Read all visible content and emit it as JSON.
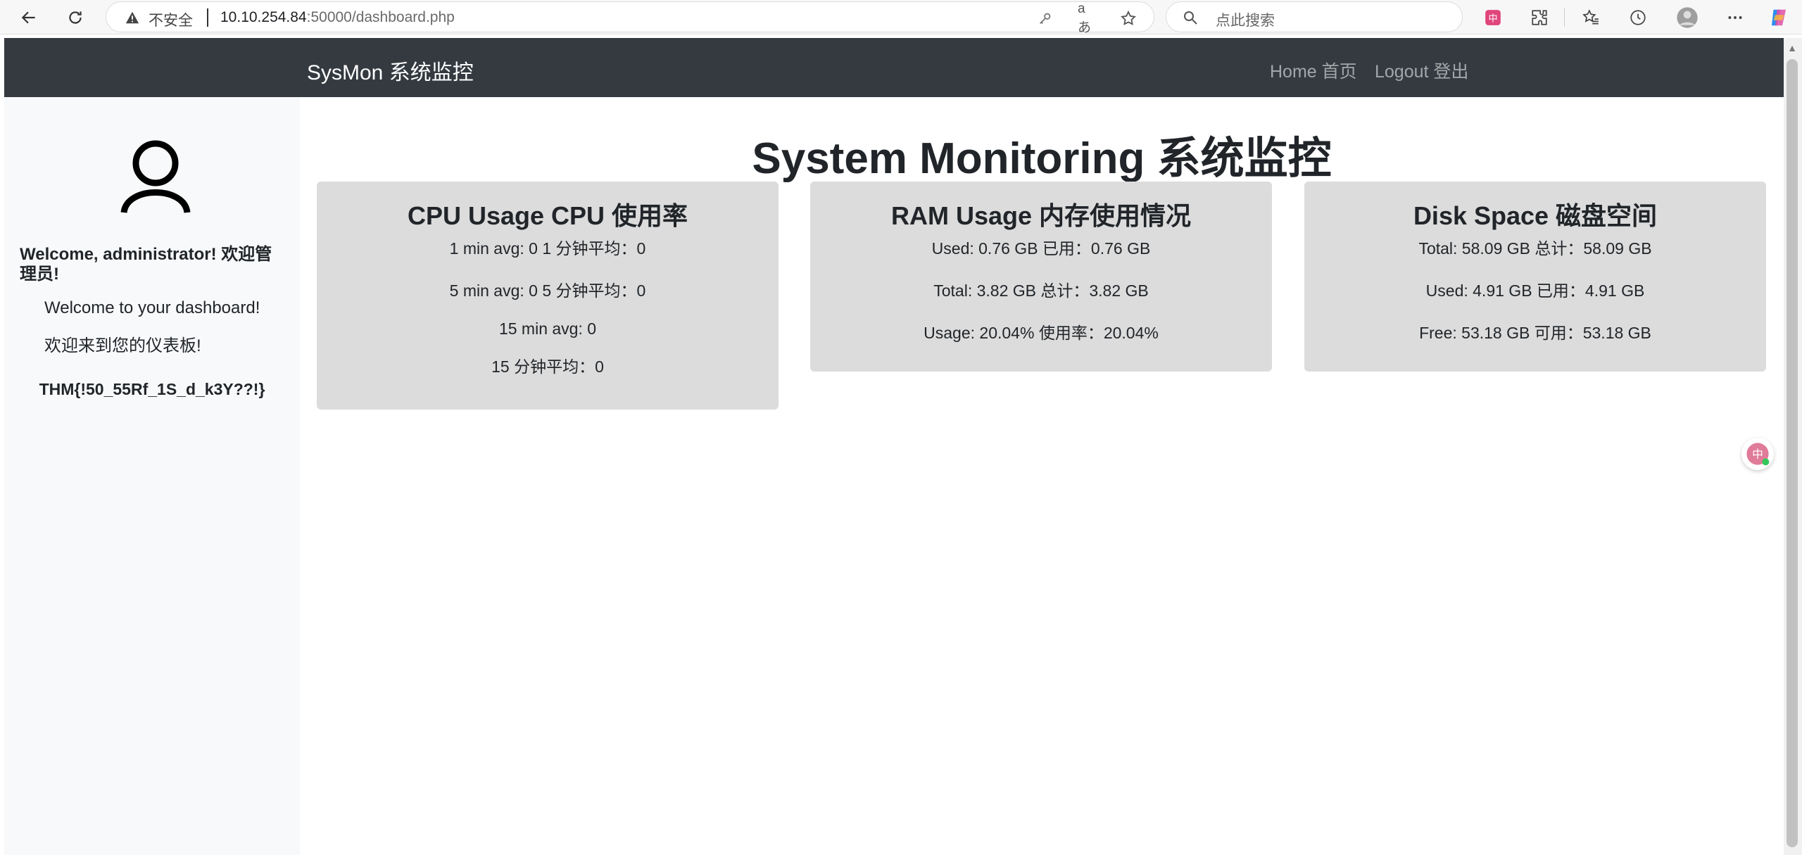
{
  "browser": {
    "insecure_label": "不安全",
    "url_host": "10.10.254.84",
    "url_path": ":50000/dashboard.php",
    "search_placeholder": "点此搜索",
    "read_aloud_label": "aあ"
  },
  "navbar": {
    "brand": "SysMon  系统监控",
    "links": [
      {
        "label": "Home  首页"
      },
      {
        "label": "Logout  登出"
      }
    ]
  },
  "sidebar": {
    "welcome_title": "Welcome, administrator!  欢迎管理员!",
    "welcome_en": "Welcome to your dashboard!",
    "welcome_zh": "欢迎来到您的仪表板!",
    "flag": "THM{!50_55Rf_1S_d_k3Y??!}"
  },
  "main": {
    "title": "System Monitoring  系统监控",
    "cards": [
      {
        "title": "CPU Usage  CPU 使用率",
        "lines": [
          "1 min avg: 0  1 分钟平均：0",
          "5 min avg: 0  5 分钟平均：0",
          "15 min avg: 0",
          "15 分钟平均：0"
        ]
      },
      {
        "title": "RAM Usage  内存使用情况",
        "lines": [
          "Used: 0.76 GB  已用：0.76 GB",
          "Total: 3.82 GB  总计：3.82 GB",
          "Usage: 20.04%  使用率：20.04%"
        ]
      },
      {
        "title": "Disk Space  磁盘空间",
        "lines": [
          "Total: 58.09 GB  总计：58.09 GB",
          "Used: 4.91 GB  已用：4.91 GB",
          "Free: 53.18 GB  可用：53.18 GB"
        ]
      }
    ]
  },
  "colors": {
    "navbar_bg": "#343a40",
    "sidebar_bg": "#f8f9fa",
    "card_bg": "#dcdcdc"
  }
}
